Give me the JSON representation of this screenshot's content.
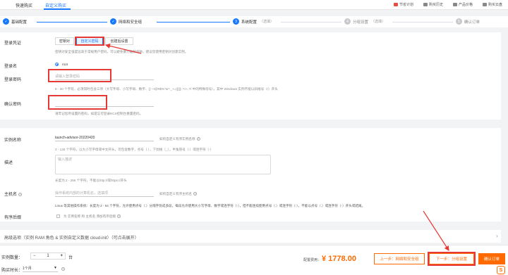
{
  "topbar": {
    "tabs": [
      {
        "label": "快速购买"
      },
      {
        "label": "自定义购买"
      }
    ],
    "links": [
      {
        "label": "节省计划",
        "icon": "badge-icon"
      },
      {
        "label": "购买历史",
        "icon": "history-icon"
      },
      {
        "label": "产品价格",
        "icon": "price-icon"
      },
      {
        "label": "购买云盘",
        "icon": "disk-icon"
      }
    ]
  },
  "steps": [
    {
      "num": "✓",
      "label": "基础配置",
      "done": true
    },
    {
      "num": "✓",
      "label": "网络和安全组",
      "done": true
    },
    {
      "num": "3",
      "label": "系统配置",
      "sub": "（选填）",
      "current": true
    },
    {
      "num": "4",
      "label": "分组设置",
      "sub": "（选填）"
    },
    {
      "num": "5",
      "label": "确认订单"
    }
  ],
  "login": {
    "label": "登录凭证",
    "options": [
      "密钥对",
      "自定义密码",
      "创建后设置"
    ],
    "hint": "密钥对安全强度远高于常规用户密码，可以避免暴力破解威胁，建议您使用密钥对创建实例。",
    "username_label": "登录名",
    "username": "root",
    "password_label": "登录密码",
    "password_placeholder": "请输入登录密码",
    "password_hint": "8 - 30 个字符，必须同时包含三项（大写字母、小写字母、数字、()`~!@#$%^&*-_+=|{}[]:;'<>,.?/ 中的特殊符号），其中 Windows 实例不能以斜线号（/）开头",
    "confirm_label": "确认密码",
    "confirm_hint": "请牢记您所设置的密码，如遗忘可登录ECS控制台重置密码。"
  },
  "instance": {
    "name_label": "实例名称",
    "name_value": "launch-advisor-20220420",
    "name_link": "如何自定义有序实例名称",
    "name_hint": "2 - 128 个字符，以大小写字母或中文开头，可包含数字，点号（.），下划线（_），半角冒号（:）或连字符（-）",
    "desc_label": "描述",
    "desc_placeholder": "输入描述",
    "desc_hint": "长度为 2 - 256 个字符，不能以http://或https://开头",
    "host_label": "主机名",
    "host_placeholder": "操作系统内部的计算机名，选填项",
    "host_link": "如何自定义有序主机名",
    "host_hint": "Linux 等其他操作系统：长度为 2 - 64 个字符，允许使用点号（.）分隔字符成多段，每段允许使用大小写字母、数字或连字符（-），但不能连续使用点号（.）或连字符（-），不能以点号（.）或连字符（-）开头或结尾。",
    "order_label": "有序后缀",
    "order_check": "为 实例名称 和 主机名 添加有序后缀"
  },
  "advanced": {
    "title": "高级选项（实例 RAM 角色 & 实例自定义数据 cloud-init）（可点击展开）"
  },
  "bottom": {
    "qty_label": "实例数量：",
    "qty": "1",
    "qty_unit": "台",
    "duration_label": "购买时长：",
    "duration": "1个月",
    "price_label": "配置费用：",
    "price": "¥ 1778.00",
    "prev_button": "上一步：网络和安全组",
    "next_button": "下一步：分组设置",
    "confirm_button": "确认订单"
  },
  "colors": {
    "accent": "#1677ff",
    "orange": "#ff6a00",
    "annotation": "#e53935"
  }
}
